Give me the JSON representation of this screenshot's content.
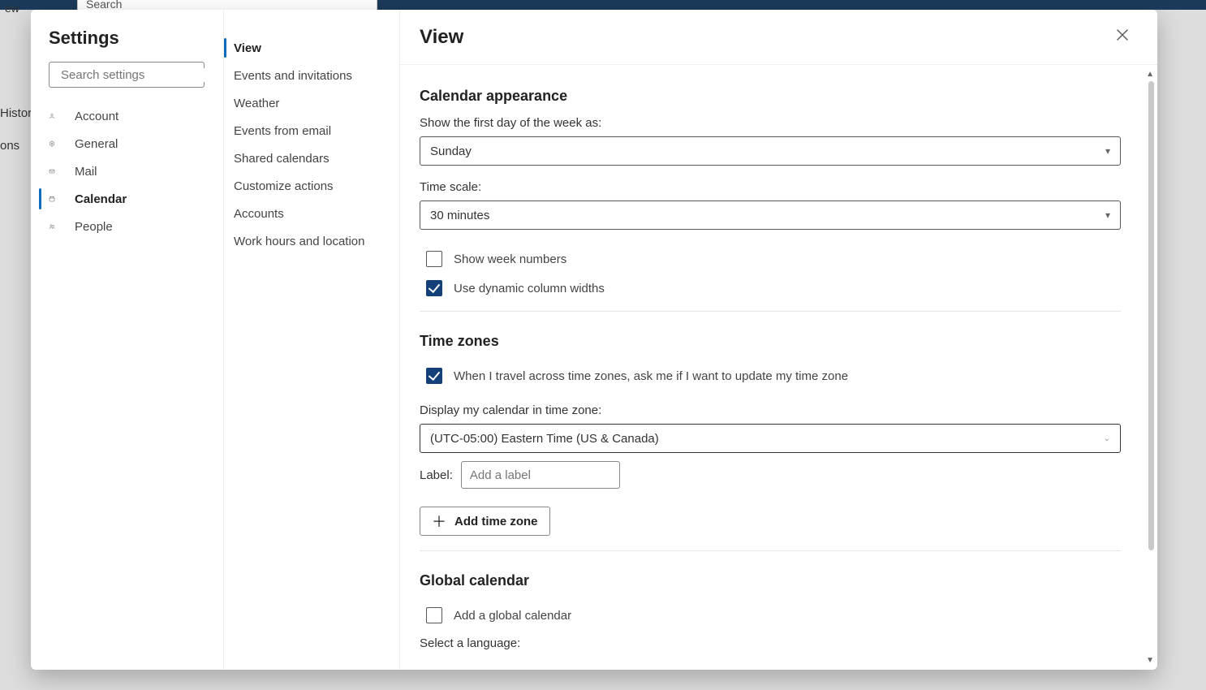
{
  "app": {
    "background_search_placeholder": "Search",
    "bg_left_items": [
      "Histor",
      "ons"
    ]
  },
  "settings": {
    "title": "Settings",
    "search_placeholder": "Search settings",
    "categories": [
      {
        "icon": "person",
        "label": "Account"
      },
      {
        "icon": "gear",
        "label": "General"
      },
      {
        "icon": "mail",
        "label": "Mail"
      },
      {
        "icon": "calendar",
        "label": "Calendar",
        "selected": true
      },
      {
        "icon": "people",
        "label": "People"
      }
    ]
  },
  "subnav": [
    {
      "label": "View",
      "selected": true
    },
    {
      "label": "Events and invitations"
    },
    {
      "label": "Weather"
    },
    {
      "label": "Events from email"
    },
    {
      "label": "Shared calendars"
    },
    {
      "label": "Customize actions"
    },
    {
      "label": "Accounts"
    },
    {
      "label": "Work hours and location"
    }
  ],
  "page": {
    "title": "View",
    "appearance": {
      "heading": "Calendar appearance",
      "first_day_label": "Show the first day of the week as:",
      "first_day_value": "Sunday",
      "time_scale_label": "Time scale:",
      "time_scale_value": "30 minutes",
      "show_week_numbers": "Show week numbers",
      "dynamic_widths": "Use dynamic column widths"
    },
    "timezones": {
      "heading": "Time zones",
      "ask_update": "When I travel across time zones, ask me if I want to update my time zone",
      "display_label": "Display my calendar in time zone:",
      "display_value": "(UTC-05:00) Eastern Time (US & Canada)",
      "label_label": "Label:",
      "label_placeholder": "Add a label",
      "add_button": "Add time zone"
    },
    "global": {
      "heading": "Global calendar",
      "add_global": "Add a global calendar",
      "select_lang": "Select a language:"
    }
  }
}
